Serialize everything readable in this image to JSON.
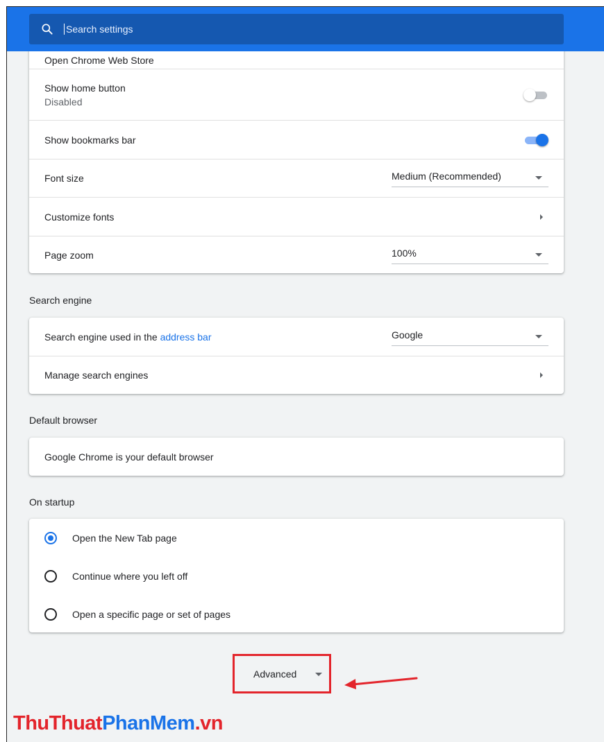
{
  "search": {
    "placeholder": "Search settings"
  },
  "appearance": {
    "partial_row_label": "Open Chrome Web Store",
    "home_button": {
      "label": "Show home button",
      "status": "Disabled",
      "enabled": false
    },
    "bookmarks_bar": {
      "label": "Show bookmarks bar",
      "enabled": true
    },
    "font_size": {
      "label": "Font size",
      "value": "Medium (Recommended)"
    },
    "customize_fonts": {
      "label": "Customize fonts"
    },
    "page_zoom": {
      "label": "Page zoom",
      "value": "100%"
    }
  },
  "search_engine": {
    "title": "Search engine",
    "used_label_prefix": "Search engine used in the ",
    "used_label_link": "address bar",
    "value": "Google",
    "manage_label": "Manage search engines"
  },
  "default_browser": {
    "title": "Default browser",
    "status": "Google Chrome is your default browser"
  },
  "on_startup": {
    "title": "On startup",
    "options": [
      {
        "label": "Open the New Tab page",
        "checked": true
      },
      {
        "label": "Continue where you left off",
        "checked": false
      },
      {
        "label": "Open a specific page or set of pages",
        "checked": false
      }
    ]
  },
  "advanced": {
    "label": "Advanced"
  },
  "watermark": {
    "part1": "ThuThuat",
    "part2": "PhanMem",
    "part3": ".vn"
  },
  "colors": {
    "accent": "#1a73e8",
    "highlight": "#e3242b"
  }
}
